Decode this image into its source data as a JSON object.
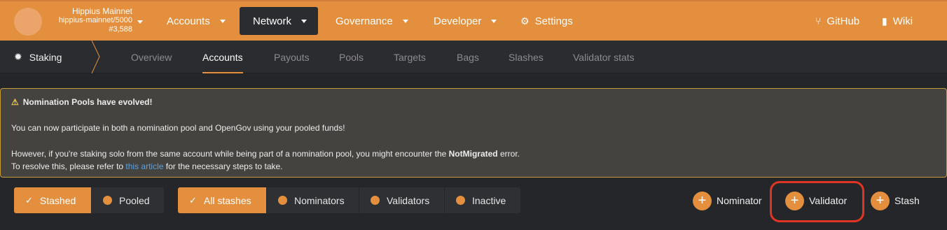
{
  "topbar": {
    "chain_name": "Hippius Mainnet",
    "chain_endpoint": "hippius-mainnet/5000",
    "chain_block": "#3,588",
    "nav": [
      {
        "label": "Accounts"
      },
      {
        "label": "Network"
      },
      {
        "label": "Governance"
      },
      {
        "label": "Developer"
      },
      {
        "label": "Settings"
      }
    ],
    "links": [
      {
        "label": "GitHub"
      },
      {
        "label": "Wiki"
      }
    ]
  },
  "subnav": {
    "section": "Staking",
    "tabs": [
      "Overview",
      "Accounts",
      "Payouts",
      "Pools",
      "Targets",
      "Bags",
      "Slashes",
      "Validator stats"
    ],
    "active_tab": "Accounts"
  },
  "notice": {
    "title": "Nomination Pools have evolved!",
    "line1": "You can now participate in both a nomination pool and OpenGov using your pooled funds!",
    "line2_pre": "However, if you're staking solo from the same account while being part of a nomination pool, you might encounter the ",
    "line2_bold": "NotMigrated",
    "line2_post": " error.",
    "line3_pre": "To resolve this, please refer to ",
    "line3_link": "this article",
    "line3_post": " for the necessary steps to take."
  },
  "filters": {
    "group1": [
      "Stashed",
      "Pooled"
    ],
    "group2": [
      "All stashes",
      "Nominators",
      "Validators",
      "Inactive"
    ]
  },
  "actions": {
    "nominator": "Nominator",
    "validator": "Validator",
    "stash": "Stash"
  }
}
